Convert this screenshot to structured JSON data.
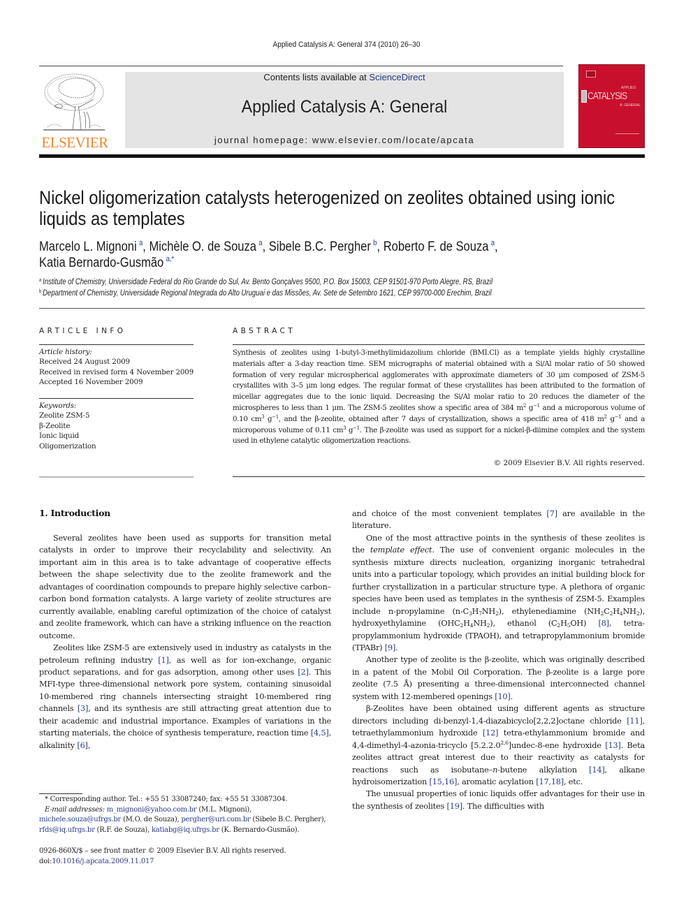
{
  "running_header": "Applied Catalysis A: General 374 (2010) 26–30",
  "masthead": {
    "publisher_logo_text": "ELSEVIER",
    "contents_prefix": "Contents lists available at ",
    "contents_link": "ScienceDirect",
    "journal_name": "Applied Catalysis A: General",
    "homepage": "journal homepage: www.elsevier.com/locate/apcata",
    "cover_title": "CATALYSIS",
    "cover_top_small": "APPLIED",
    "cover_sub_small": "A: GENERAL",
    "colors": {
      "publisher_orange": "#f0862e",
      "cover_red": "#c8102e",
      "banner_grey": "#e4e4e4",
      "link_blue": "#2a3a8c"
    }
  },
  "article": {
    "title": "Nickel oligomerization catalysts heterogenized on zeolites obtained using ionic liquids as templates",
    "authors": [
      {
        "name": "Marcelo L. Mignoni",
        "aff": "a",
        "sep": ", "
      },
      {
        "name": "Michèle O. de Souza",
        "aff": "a",
        "sep": ", "
      },
      {
        "name": "Sibele B.C. Pergher",
        "aff": "b",
        "sep": ", "
      },
      {
        "name": "Roberto F. de Souza",
        "aff": "a",
        "sep": ","
      },
      {
        "name": "Katia Bernardo-Gusmão",
        "aff": "a,*",
        "sep": ""
      }
    ],
    "affiliations": [
      {
        "mark": "a",
        "text": "Institute of Chemistry, Universidade Federal do Rio Grande do Sul, Av. Bento Gonçalves 9500, P.O. Box 15003, CEP 91501-970 Porto Alegre, RS, Brazil"
      },
      {
        "mark": "b",
        "text": "Department of Chemistry, Universidade Regional Integrada do Alto Uruguai e das Missões, Av. Sete de Setembro 1621, CEP 99700-000 Erechim, Brazil"
      }
    ]
  },
  "article_info": {
    "heading": "ARTICLE INFO",
    "history_label": "Article history:",
    "history": [
      "Received 24 August 2009",
      "Received in revised form 4 November 2009",
      "Accepted 16 November 2009"
    ],
    "keywords_label": "Keywords:",
    "keywords": [
      "Zeolite ZSM-5",
      "β-Zeolite",
      "Ionic liquid",
      "Oligomerization"
    ]
  },
  "abstract": {
    "heading": "ABSTRACT",
    "p1": "Synthesis of zeolites using 1-butyl-3-methylimidazolium chloride (BMI.Cl) as a template yields highly crystalline materials after a 3-day reaction time. SEM micrographs of material obtained with a Si/Al molar ratio of 50 showed formation of very regular microspherical agglomerates with approximate diameters of 30 μm composed of ZSM-5 crystallites with 3–5 μm long edges. The regular format of these crystallites has been attributed to the formation of micellar aggregates due to the ionic liquid. Decreasing the Si/Al molar ratio to 20 reduces the diameter of the microspheres to less than 1 μm. The ZSM-5 zeolites show a specific area of 384 m",
    "p2": " g",
    "p3": " and a microporous volume of 0.10 cm",
    "p4": " g",
    "p5": ", and the β-zeolite, obtained after 7 days of crystallization, shows a specific area of 418 m",
    "p6": " g",
    "p7": " and a microporous volume of 0.11 cm",
    "p8": " g",
    "p9": ". The β-zeolite was used as support for a nickel-β-diimine complex and the system used in ethylene catalytic oligomerization reactions.",
    "sup2": "2",
    "sup3": "3",
    "supm1": "−1",
    "copyright": "© 2009 Elsevier B.V. All rights reserved."
  },
  "body": {
    "section_heading": "1.  Introduction",
    "left_p1": "Several zeolites have been used as supports for transition metal catalysts in order to improve their recyclability and selectivity. An important aim in this area is to take advantage of cooperative effects between the shape selectivity due to the zeolite framework and the advantages of coordination compounds to prepare highly selective carbon–carbon bond formation catalysts. A large variety of zeolite structures are currently available, enabling careful optimization of the choice of catalyst and zeolite framework, which can have a striking influence on the reaction outcome.",
    "left_p2": {
      "t1": "Zeolites like ZSM-5 are extensively used in industry as catalysts in the petroleum refining industry ",
      "r1": "[1]",
      "t2": ", as well as for ion-exchange, organic product separations, and for gas adsorption, among other uses ",
      "r2": "[2]",
      "t3": ". This MFI-type three-dimensional network pore system, containing sinusoidal 10-membered ring channels intersecting straight 10-membered ring channels ",
      "r3": "[3]",
      "t4": ", and its synthesis are still attracting great attention due to their academic and industrial importance. Examples of variations in the starting materials, the choice of synthesis temperature, reaction time ",
      "r4": "[4,5]",
      "t5": ", alkalinity ",
      "r5": "[6]",
      "t6": ","
    },
    "right_p0": {
      "t1": "and choice of the most convenient templates ",
      "r1": "[7]",
      "t2": " are available in the literature."
    },
    "right_p1": {
      "t1": "One of the most attractive points in the synthesis of these zeolites is the ",
      "em": "template effect",
      "t2": ". The use of convenient organic molecules in the synthesis mixture directs nucleation, organizing inorganic tetrahedral units into a particular topology, which provides an initial building block for further crystallization in a particular structure type. A plethora of organic species have been used as templates in the synthesis of ZSM-5. Examples include n-propylamine (n-C",
      "s3": "3",
      "h": "H",
      "s7": "7",
      "nh": "NH",
      "s2": "2",
      "t3": "), ethylenediamine (NH",
      "c": "C",
      "s4": "4",
      "t4": "), hydroxyethylamine (OHC",
      "t5": "), ethanol (C",
      "s5": "5",
      "oh": "OH) ",
      "r8": "[8]",
      "t6": ", tetra-propylammonium hydroxide (TPAOH), and tetrapropylammonium bromide (TPABr) ",
      "r9": "[9]",
      "t7": "."
    },
    "right_p2": {
      "t1": "Another type of zeolite is the β-zeolite, which was originally described in a patent of the Mobil Oil Corporation. The β-zeolite is a large pore zeolite (7.5 Å) presenting a three-dimensional interconnected channel system with 12-membered openings ",
      "r10": "[10]",
      "t2": "."
    },
    "right_p3": {
      "t1": "β-Zeolites have been obtained using different agents as structure directors including di-benzyl-1,4-diazabicyclo[2,2,2]octane chloride ",
      "r11": "[11]",
      "t2": ", tetraethylammonium hydroxide ",
      "r12": "[12]",
      "t3": " tetra-ethylammonium bromide and 4,4-dimethyl-4-azonia-tricyclo [5.2.2.0",
      "sup": "2,6",
      "t4": "]undec-8-ene hydroxide ",
      "r13": "[13]",
      "t5": ". Beta zeolites attract great interest due to their reactivity as catalysts for reactions such as isobutane–",
      "em": "n",
      "t6": "-butene alkylation ",
      "r14": "[14]",
      "t7": ", alkane hydroisomerization ",
      "r15": "[15,16]",
      "t8": ", aromatic acylation ",
      "r17": "[17,18]",
      "t9": ", etc."
    },
    "right_p4": {
      "t1": "The unusual properties of ionic liquids offer advantages for their use in the synthesis of zeolites ",
      "r19": "[19]",
      "t2": ". The difficulties with"
    }
  },
  "footnotes": {
    "corresponding": "* Corresponding author. Tel.: +55 51 33087240; fax: +55 51 33087304.",
    "email_label": "E-mail addresses:",
    "emails": [
      {
        "addr": "m_mignoni@yahoo.com.br",
        "who": " (M.L. Mignoni),",
        "sep": ""
      },
      {
        "addr": "michele.souza@ufrgs.br",
        "who": " (M.O. de Souza), ",
        "sep": ""
      },
      {
        "addr": "pergher@uri.com.br",
        "who": " (Sibele B.C. Pergher),",
        "sep": ""
      },
      {
        "addr": "rfds@iq.ufrgs.br",
        "who": " (R.F. de Souza), ",
        "sep": ""
      },
      {
        "addr": "katiabg@iq.ufrgs.br",
        "who": " (K. Bernardo-Gusmão).",
        "sep": ""
      }
    ],
    "front_matter": "0926-860X/$ – see front matter © 2009 Elsevier B.V. All rights reserved.",
    "doi_label": "doi:",
    "doi": "10.1016/j.apcata.2009.11.017"
  }
}
